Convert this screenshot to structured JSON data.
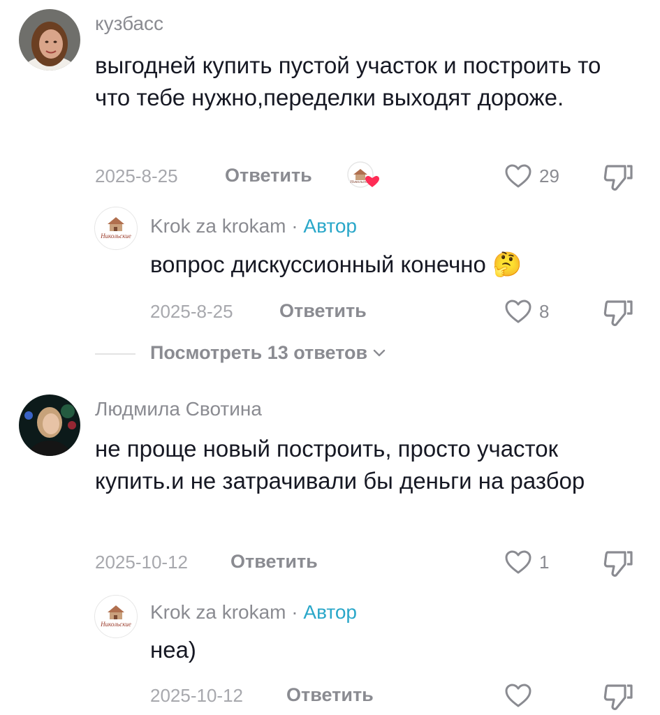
{
  "comments": [
    {
      "username": "кузбасс",
      "text": "выгодней купить пустой участок и построить то что тебе нужно,переделки выходят дороже.",
      "date": "2025-8-25",
      "reply_label": "Ответить",
      "likes": "29",
      "reply": {
        "username": "Krok za krokam",
        "separator": "·",
        "author_badge": "Автор",
        "text": "вопрос дискуссионный конечно",
        "emoji": "🤔",
        "date": "2025-8-25",
        "reply_label": "Ответить",
        "likes": "8"
      },
      "view_replies": "Посмотреть 13 ответов"
    },
    {
      "username": "Людмила Свотина",
      "text": "не проще новый построить, просто участок купить.и не затрачивали бы деньги на разбор",
      "date": "2025-10-12",
      "reply_label": "Ответить",
      "likes": "1",
      "reply": {
        "username": "Krok za krokam",
        "separator": "·",
        "author_badge": "Автор",
        "text": "неа)",
        "date": "2025-10-12",
        "reply_label": "Ответить",
        "likes": ""
      }
    }
  ],
  "logo": {
    "brand_text": "Никольские"
  },
  "colors": {
    "author_badge": "#2aa7c9",
    "like_heart": "#fe2c55",
    "muted": "#8a8b91"
  },
  "icons": [
    "heart-outline-icon",
    "dislike-icon",
    "chevron-down-icon",
    "creator-liked-icon"
  ]
}
